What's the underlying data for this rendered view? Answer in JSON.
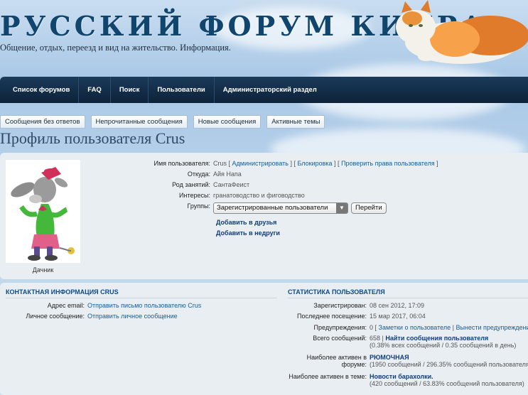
{
  "header": {
    "logo": "РУССКИЙ ФОРУМ КИПРА",
    "tagline": "Общение, отдых, переезд и вид на жительство. Информация."
  },
  "nav": [
    {
      "label": "Список форумов"
    },
    {
      "label": "FAQ"
    },
    {
      "label": "Поиск"
    },
    {
      "label": "Пользователи"
    },
    {
      "label": "Администраторский раздел"
    }
  ],
  "subnav": [
    {
      "label": "Сообщения без ответов"
    },
    {
      "label": "Непрочитанные сообщения"
    },
    {
      "label": "Новые сообщения"
    },
    {
      "label": "Активные темы"
    }
  ],
  "page_title": "Профиль пользователя Crus",
  "profile": {
    "avatar_caption": "Дачник",
    "username_label": "Имя пользователя:",
    "username": "Crus",
    "admin_link": "Администрировать",
    "ban_link": "Блокировка",
    "permissions_link": "Проверить права пользователя",
    "location_label": "Откуда:",
    "location": "Айя Напа",
    "occupation_label": "Род занятий:",
    "occupation": "СантаФеист",
    "interests_label": "Интересы:",
    "interests": "гранатоводство и фиговодство",
    "groups_label": "Группы:",
    "group_selected": "Зарегистрированные пользователи",
    "go_button": "Перейти",
    "add_friend": "Добавить в друзья",
    "add_foe": "Добавить в недруги"
  },
  "contact": {
    "title": "КОНТАКТНАЯ ИНФОРМАЦИЯ CRUS",
    "email_label": "Адрес email:",
    "email_link": "Отправить письмо пользователю Crus",
    "pm_label": "Личное сообщение:",
    "pm_link": "Отправить личное сообщение"
  },
  "stats": {
    "title": "СТАТИСТИКА ПОЛЬЗОВАТЕЛЯ",
    "joined_label": "Зарегистрирован:",
    "joined": "08 сен 2012, 17:09",
    "last_visit_label": "Последнее посещение:",
    "last_visit": "15 мар 2017, 06:04",
    "warnings_label": "Предупреждения:",
    "warnings_count": "0",
    "notes_link": "Заметки о пользователе",
    "warn_link": "Вынести предупреждение",
    "posts_label": "Всего сообщений:",
    "posts_count": "658",
    "find_posts_link": "Найти сообщения пользователя",
    "posts_detail": "(0.38% всех сообщений / 0.35 сообщений в день)",
    "active_forum_label_1": "Наиболее активен в",
    "active_forum_label_2": "форуме:",
    "active_forum": "РЮМОЧНАЯ",
    "active_forum_detail": "(1950 сообщений / 296.35% сообщений пользователя)",
    "active_topic_label": "Наиболее активен в теме:",
    "active_topic": "Новости барахолки.",
    "active_topic_detail": "(420 сообщений / 63.83% сообщений пользователя)"
  }
}
